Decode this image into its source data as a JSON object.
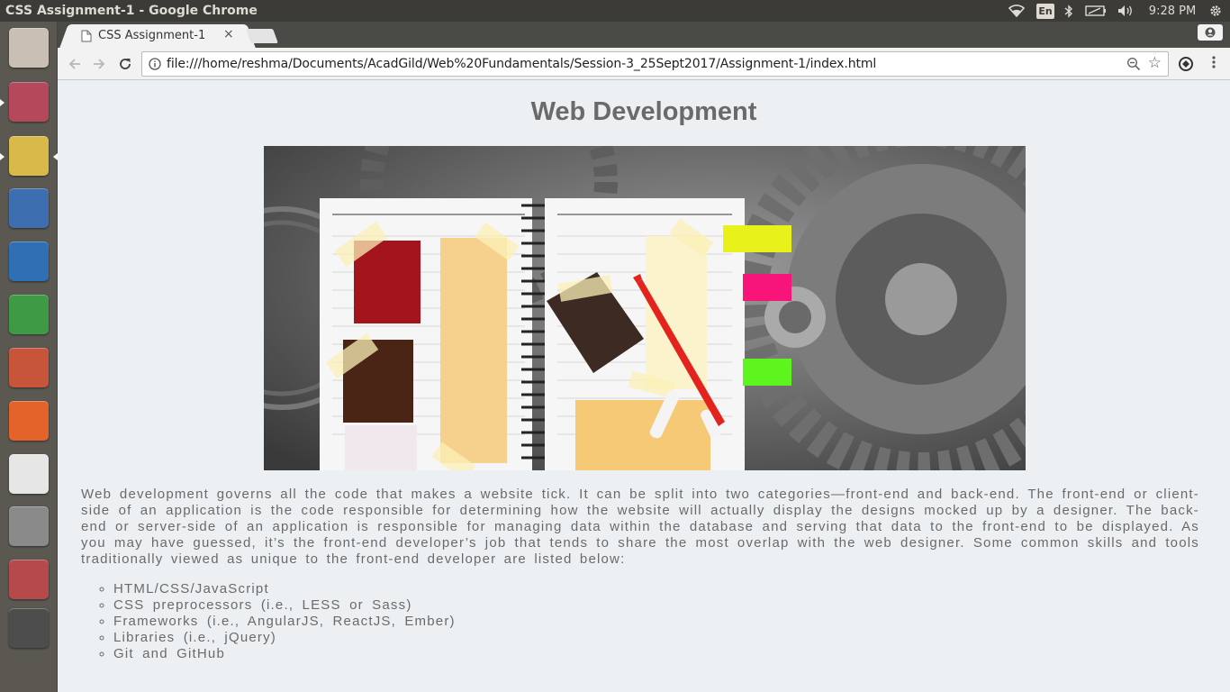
{
  "panel": {
    "window_title": "CSS Assignment-1 - Google Chrome",
    "language": "En",
    "clock": "9:28 PM"
  },
  "launcher": {
    "items": [
      {
        "name": "ubuntu-dash",
        "color": "#c9bfb4"
      },
      {
        "name": "files",
        "color": "#b5495b"
      },
      {
        "name": "google-chrome",
        "color": "#d9b94a"
      },
      {
        "name": "firefox",
        "color": "#3d6fb0"
      },
      {
        "name": "libreoffice-writer",
        "color": "#2f6fb3"
      },
      {
        "name": "libreoffice-calc",
        "color": "#3f9a45"
      },
      {
        "name": "libreoffice-impress",
        "color": "#c7553a"
      },
      {
        "name": "ubuntu-software",
        "color": "#e4632a"
      },
      {
        "name": "amazon",
        "color": "#e6e6e6"
      },
      {
        "name": "system-settings",
        "color": "#8a8a8a"
      },
      {
        "name": "text-editor",
        "color": "#b5494b"
      },
      {
        "name": "sublime-text",
        "color": "#4d4d4d"
      }
    ]
  },
  "browser": {
    "tab": {
      "title": "CSS Assignment-1",
      "close": "×"
    },
    "url": "file:///home/reshma/Documents/AcadGild/Web%20Fundamentals/Session-3_25Sept2017/Assignment-1/index.html"
  },
  "page": {
    "title": "Web Development",
    "paragraph": "Web development governs all the code that makes a website tick. It can be split into two categories—front-end and back-end. The front-end or client-side of an application is the code responsible for determining how the website will actually display the designs mocked up by a designer. The back-end or server-side of an application is responsible for managing data within the database and serving that data to the front-end to be displayed. As you may have guessed, it’s the front-end developer’s job that tends to share the most overlap with the web designer. Some common skills and tools traditionally viewed as unique to the front-end developer are listed below:",
    "skills": [
      "HTML/CSS/JavaScript",
      "CSS preprocessors (i.e., LESS or Sass)",
      "Frameworks (i.e., AngularJS, ReactJS, Ember)",
      "Libraries (i.e., jQuery)",
      "Git and GitHub"
    ]
  }
}
